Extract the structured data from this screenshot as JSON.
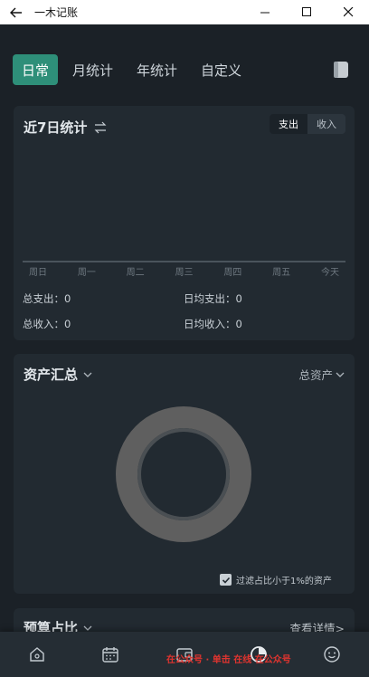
{
  "window": {
    "title": "一木记账"
  },
  "tabs": [
    {
      "label": "日常",
      "active": true
    },
    {
      "label": "月统计"
    },
    {
      "label": "年统计"
    },
    {
      "label": "自定义"
    }
  ],
  "stats_card": {
    "title": "近7日统计",
    "toggle": {
      "expense": "支出",
      "income": "收入",
      "selected": "expense"
    },
    "days": [
      "周日",
      "周一",
      "周二",
      "周三",
      "周四",
      "周五",
      "今天"
    ],
    "total_expense_label": "总支出：",
    "total_expense_value": "0",
    "avg_expense_label": "日均支出：",
    "avg_expense_value": "0",
    "total_income_label": "总收入：",
    "total_income_value": "0",
    "avg_income_label": "日均收入：",
    "avg_income_value": "0"
  },
  "assets_card": {
    "title": "资产汇总",
    "type_selector": "总资产",
    "filter_label": "过滤占比小于1%的资产",
    "filter_checked": true
  },
  "budget_card": {
    "title": "预算占比",
    "detail_link": "查看详情>"
  },
  "bottom_nav": [
    "home-icon",
    "calendar-icon",
    "wallet-icon",
    "chart-icon",
    "smile-icon"
  ],
  "watermark": "在公众号 · 单击 在线 在公众号",
  "colors": {
    "accent": "#2e8f79",
    "background": "#1b2127",
    "card": "#222a31",
    "donut": "#5f5f5f"
  }
}
